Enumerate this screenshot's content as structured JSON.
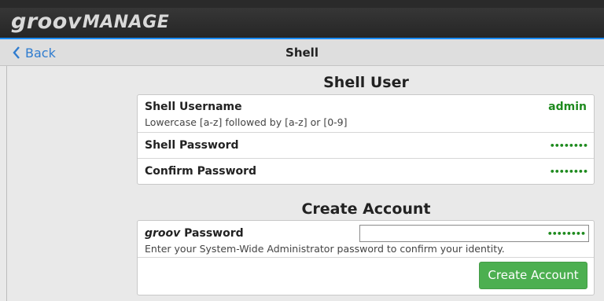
{
  "app": {
    "brand_part1": "groov",
    "brand_part2": "MANAGE"
  },
  "nav": {
    "back_label": "Back",
    "title": "Shell"
  },
  "shell_user": {
    "heading": "Shell User",
    "username_label": "Shell Username",
    "username_hint": "Lowercase [a-z] followed by [a-z] or [0-9]",
    "username_value": "admin",
    "password_label": "Shell Password",
    "password_value": "••••••••",
    "confirm_label": "Confirm Password",
    "confirm_value": "••••••••"
  },
  "create_account": {
    "heading": "Create Account",
    "groov_word": "groov",
    "password_label": "Password",
    "password_value": "••••••••",
    "hint": "Enter your System-Wide Administrator password to confirm your identity.",
    "button_label": "Create Account"
  },
  "colors": {
    "accent": "#1a8cff",
    "value_green": "#1e8a1e",
    "button_green": "#4caf50",
    "link_blue": "#2f7ccf"
  }
}
